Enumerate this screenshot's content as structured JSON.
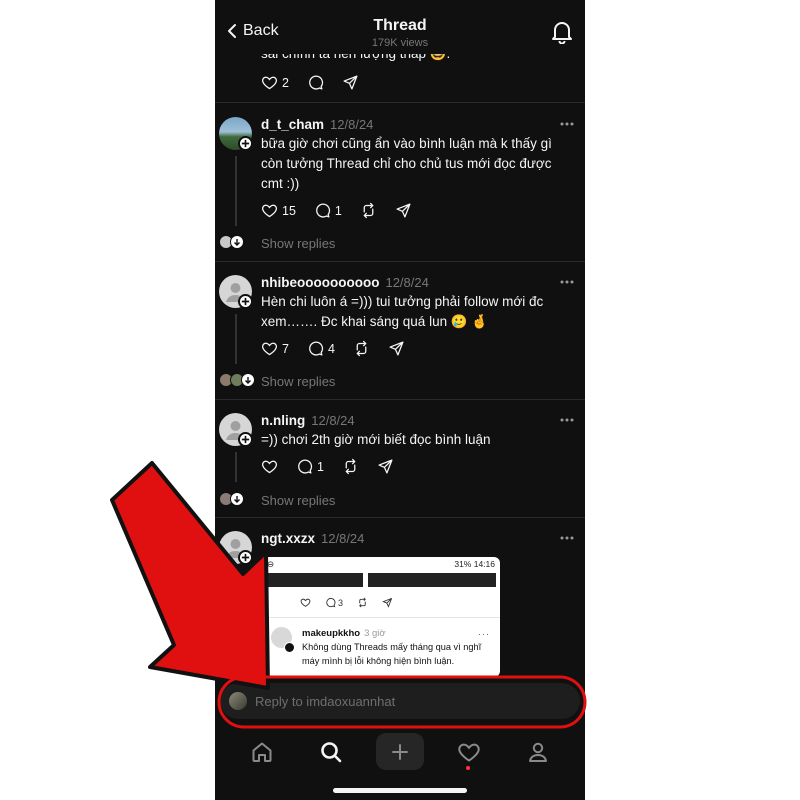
{
  "header": {
    "back_label": "Back",
    "title": "Thread",
    "views": "179K views"
  },
  "previous_post": {
    "text_tail": "sai chính tả nên lượng thấp 🤓.",
    "likes": "2"
  },
  "posts": [
    {
      "username": "d_t_cham",
      "date": "12/8/24",
      "lines": [
        "bữa giờ chơi cũng ẩn vào bình luận mà k thấy gì",
        " còn tưởng Thread chỉ cho chủ tus mới đọc được",
        "cmt :))"
      ],
      "likes": "15",
      "replies": "1",
      "show_replies": "Show replies"
    },
    {
      "username": "nhibeoooooooooo",
      "date": "12/8/24",
      "lines": [
        "Hèn chi luôn á =))) tui tưởng phải follow mới đc",
        "xem……. Đc khai sáng quá lun 🥲 🤞"
      ],
      "likes": "7",
      "replies": "4",
      "show_replies": "Show replies"
    },
    {
      "username": "n.nling",
      "date": "12/8/24",
      "lines": [
        "=)) chơi 2th giờ mới biết đọc bình luận"
      ],
      "likes": "",
      "replies": "1",
      "show_replies": "Show replies"
    },
    {
      "username": "ngt.xxzx",
      "date": "12/8/24"
    }
  ],
  "embedded_screenshot": {
    "status_right": "31% 14:16",
    "reply_count": "3",
    "username": "makeupkkho",
    "time": "3 giờ",
    "lines": [
      "Không dùng Threads mấy tháng qua vì nghĩ",
      "máy mình bị lỗi không hiện bình luận."
    ]
  },
  "reply": {
    "placeholder": "Reply to imdaoxuannhat"
  },
  "nav": {
    "items": [
      "home-icon",
      "search-icon",
      "plus-icon",
      "heart-icon",
      "profile-icon"
    ]
  },
  "colors": {
    "background": "#101010",
    "text": "#f3f5f7",
    "muted": "#777777",
    "annotation_red": "#e01010",
    "notification_dot": "#ff3040"
  }
}
